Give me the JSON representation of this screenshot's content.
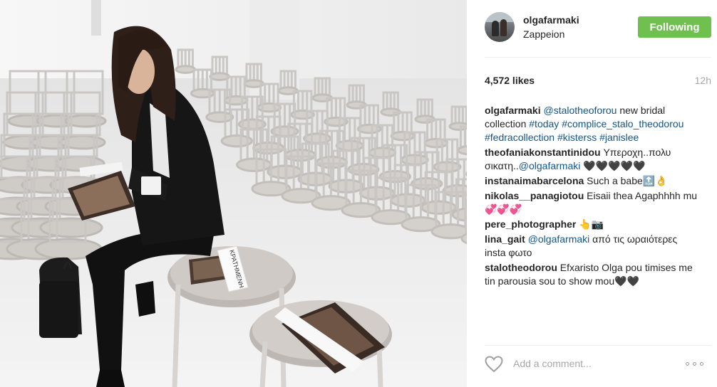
{
  "post": {
    "username": "olgafarmaki",
    "location": "Zappeion",
    "follow_label": "Following",
    "likes": "4,572 likes",
    "time": "12h",
    "seat_sign": "ΚΡΑΤΗΜΕΝΗ"
  },
  "comments": [
    {
      "author": "olgafarmaki",
      "parts": [
        {
          "t": "@stalotheoforou",
          "link": true
        },
        {
          "t": " new bridal collection ",
          "link": false
        },
        {
          "t": "#today",
          "link": true
        },
        {
          "t": " ",
          "link": false
        },
        {
          "t": "#complice_stalo_theodorou",
          "link": true
        },
        {
          "t": " ",
          "link": false
        },
        {
          "t": "#fedracollection",
          "link": true
        },
        {
          "t": " ",
          "link": false
        },
        {
          "t": "#kisterss",
          "link": true
        },
        {
          "t": " ",
          "link": false
        },
        {
          "t": "#janislee",
          "link": true
        }
      ]
    },
    {
      "author": "theofaniakonstantinidou",
      "parts": [
        {
          "t": "Υπεροχη..πολυ σικατη..",
          "link": false
        },
        {
          "t": "@olgafarmaki",
          "link": true
        },
        {
          "t": " 🖤🖤🖤🖤🖤",
          "link": false
        }
      ]
    },
    {
      "author": "instanaimabarcelona",
      "parts": [
        {
          "t": "Such a babe",
          "link": false
        },
        {
          "t": "🔝👌",
          "link": false
        }
      ]
    },
    {
      "author": "nikolas__panagiotou",
      "parts": [
        {
          "t": "Eisaii thea Agaphhhh mu 💞💞💞",
          "link": false
        }
      ]
    },
    {
      "author": "pere_photographer",
      "parts": [
        {
          "t": "👆📷",
          "link": false
        }
      ]
    },
    {
      "author": "lina_gait",
      "parts": [
        {
          "t": "@olgafarmaki",
          "link": true
        },
        {
          "t": " από τις ωραιότερες insta φωτο",
          "link": false
        }
      ]
    },
    {
      "author": "stalotheodorou",
      "parts": [
        {
          "t": "Efxaristo Olga pou timises me tin parousia sou to show mou",
          "link": false
        },
        {
          "t": "🖤🖤",
          "link": false
        }
      ]
    }
  ],
  "add_comment": {
    "placeholder": "Add a comment..."
  },
  "icons": {
    "like": "heart-icon",
    "more": "more-options-icon"
  },
  "colors": {
    "follow": "#70c050",
    "link": "#125688",
    "muted": "#a5a7aa"
  }
}
